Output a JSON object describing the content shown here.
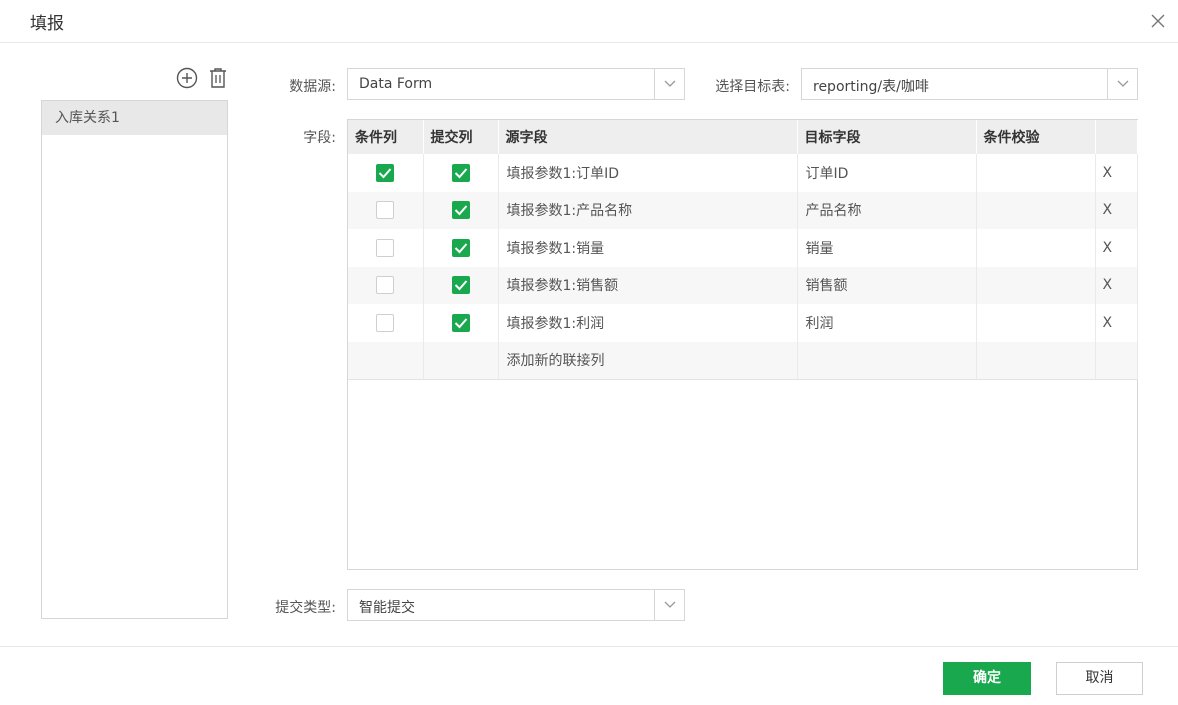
{
  "dialog": {
    "title": "填报"
  },
  "relations": {
    "items": [
      "入库关系1"
    ]
  },
  "form": {
    "source_label": "数据源:",
    "source_value": "Data Form",
    "target_label": "选择目标表:",
    "target_value": "reporting/表/咖啡",
    "fields_label": "字段:",
    "submit_type_label": "提交类型:",
    "submit_type_value": "智能提交"
  },
  "grid": {
    "headers": [
      "条件列",
      "提交列",
      "源字段",
      "目标字段",
      "条件校验",
      ""
    ],
    "rows": [
      {
        "condition": true,
        "submit": true,
        "source": "填报参数1:订单ID",
        "target": "订单ID",
        "check": "",
        "delete": "X"
      },
      {
        "condition": false,
        "submit": true,
        "source": "填报参数1:产品名称",
        "target": "产品名称",
        "check": "",
        "delete": "X"
      },
      {
        "condition": false,
        "submit": true,
        "source": "填报参数1:销量",
        "target": "销量",
        "check": "",
        "delete": "X"
      },
      {
        "condition": false,
        "submit": true,
        "source": "填报参数1:销售额",
        "target": "销售额",
        "check": "",
        "delete": "X"
      },
      {
        "condition": false,
        "submit": true,
        "source": "填报参数1:利润",
        "target": "利润",
        "check": "",
        "delete": "X"
      }
    ],
    "add_row_label": "添加新的联接列"
  },
  "buttons": {
    "ok": "确定",
    "cancel": "取消"
  },
  "colors": {
    "accent": "#1aa84f",
    "header_bg": "#eeeeee",
    "selected_item_bg": "#e8e8e8"
  },
  "icons": [
    "close-icon",
    "add-circle-icon",
    "trash-icon",
    "chevron-down-icon",
    "checkmark-icon"
  ]
}
